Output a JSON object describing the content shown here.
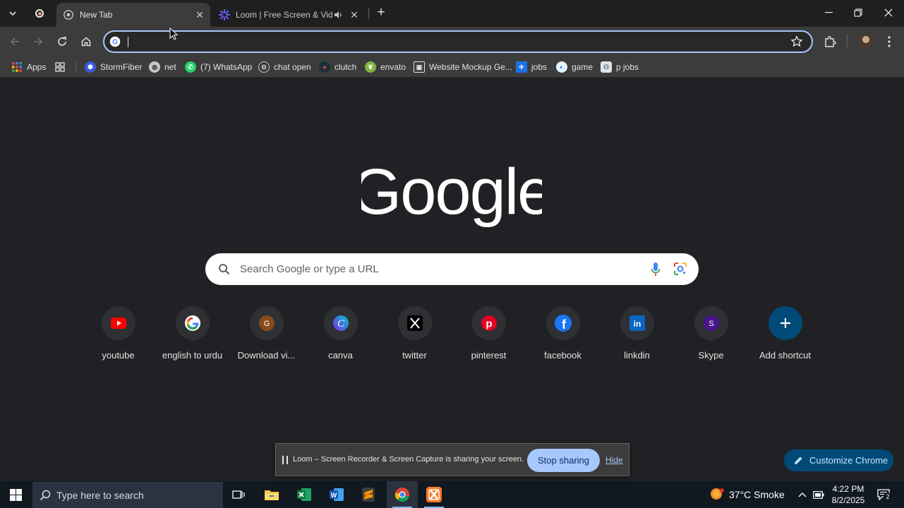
{
  "tabs": [
    {
      "title": "New Tab",
      "active": true
    },
    {
      "title": "Loom | Free Screen & Video Recording Software",
      "active": false,
      "audio": true
    }
  ],
  "omnibox": {
    "value": "",
    "placeholder": ""
  },
  "bookmarks": [
    {
      "label": "Apps",
      "icon": "apps-grid-icon"
    },
    {
      "label": "",
      "icon": "tab-groups-icon"
    },
    {
      "label": "StormFiber",
      "icon": "stormfiber-icon"
    },
    {
      "label": "net",
      "icon": "globe-icon"
    },
    {
      "label": "(7) WhatsApp",
      "icon": "whatsapp-icon"
    },
    {
      "label": "chat open",
      "icon": "openai-icon"
    },
    {
      "label": "clutch",
      "icon": "clutch-icon"
    },
    {
      "label": "envato",
      "icon": "envato-icon"
    },
    {
      "label": "Website Mockup Ge...",
      "icon": "mockup-icon"
    },
    {
      "label": "jobs",
      "icon": "jobs-icon"
    },
    {
      "label": "game",
      "icon": "game-icon"
    },
    {
      "label": "p jobs",
      "icon": "pjobs-icon"
    }
  ],
  "search": {
    "placeholder": "Search Google or type a URL"
  },
  "shortcuts": [
    {
      "label": "youtube",
      "icon": "youtube-icon"
    },
    {
      "label": "english to urdu",
      "icon": "google-icon"
    },
    {
      "label": "Download vi...",
      "icon": "g-letter-icon"
    },
    {
      "label": "canva",
      "icon": "canva-icon"
    },
    {
      "label": "twitter",
      "icon": "x-icon"
    },
    {
      "label": "pinterest",
      "icon": "pinterest-icon"
    },
    {
      "label": "facebook",
      "icon": "facebook-icon"
    },
    {
      "label": "linkdin",
      "icon": "linkedin-icon"
    },
    {
      "label": "Skype",
      "icon": "s-letter-icon"
    },
    {
      "label": "Add shortcut",
      "icon": "plus-icon"
    }
  ],
  "loom_bar": {
    "message": "Loom – Screen Recorder & Screen Capture is sharing your screen.",
    "stop_label": "Stop sharing",
    "hide_label": "Hide"
  },
  "customize": {
    "label": "Customize Chrome"
  },
  "taskbar": {
    "search_placeholder": "Type here to search",
    "weather": "37°C  Smoke",
    "time": "4:22 PM",
    "date": "8/2/2025",
    "notifications": "2"
  },
  "colors": {
    "accent": "#a8c7fa",
    "customize_bg": "#004a77",
    "page_bg": "#202124"
  }
}
